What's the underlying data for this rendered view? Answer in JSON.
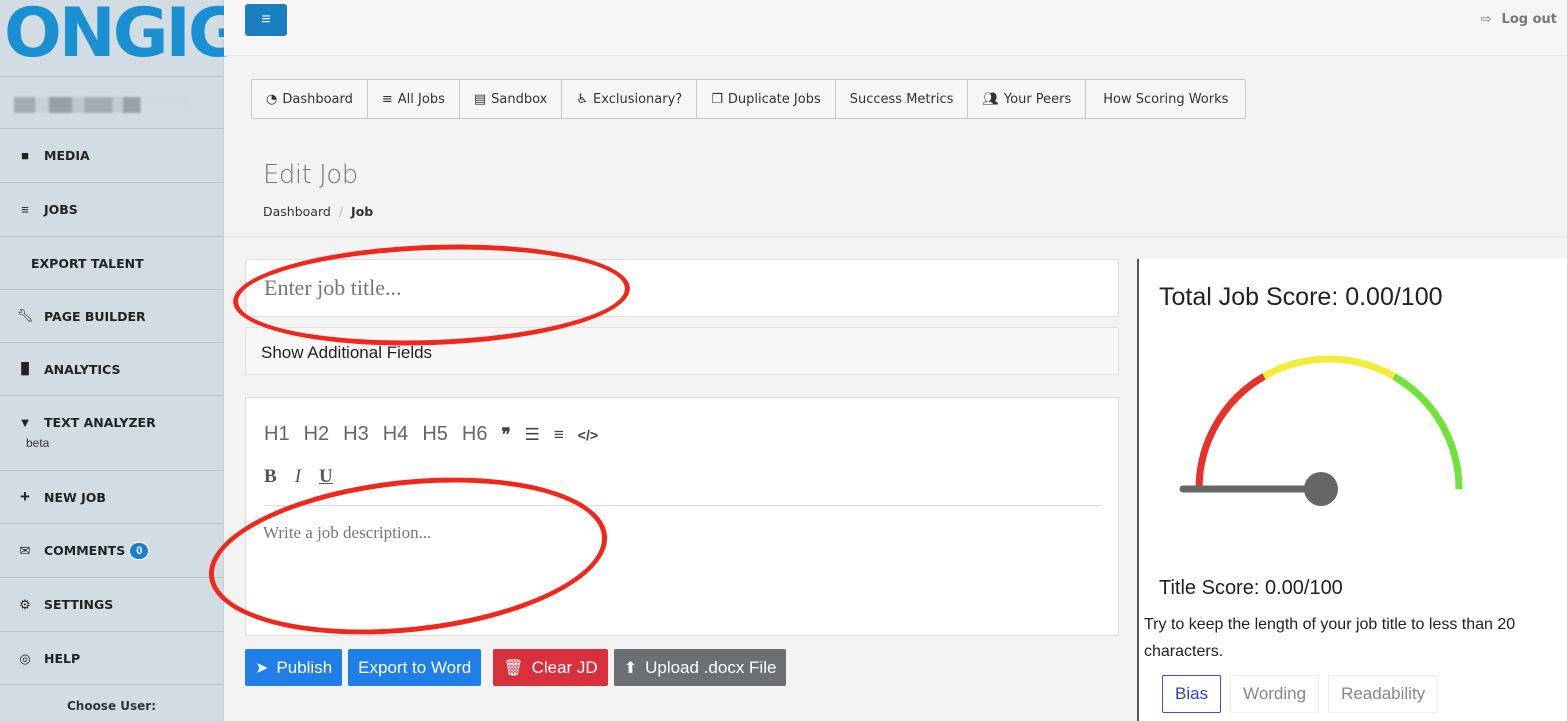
{
  "brand": {
    "logo_text": "ONGIG",
    "logo_color": "#1a8fd2"
  },
  "sidebar": {
    "items": [
      {
        "label": "MEDIA",
        "icon": "video-camera-icon"
      },
      {
        "label": "JOBS",
        "icon": "list-icon"
      },
      {
        "label": "EXPORT TALENT",
        "icon": ""
      },
      {
        "label": "PAGE BUILDER",
        "icon": "wrench-icon"
      },
      {
        "label": "ANALYTICS",
        "icon": "bar-chart-icon"
      },
      {
        "label": "TEXT ANALYZER",
        "sub": "beta",
        "icon": "graduation-cap-icon"
      },
      {
        "label": "NEW JOB",
        "icon": "plus-icon"
      },
      {
        "label": "COMMENTS",
        "badge": "0",
        "icon": "envelope-icon"
      },
      {
        "label": "SETTINGS",
        "icon": "gear-icon"
      },
      {
        "label": "HELP",
        "icon": "life-ring-icon"
      }
    ],
    "choose_user_label": "Choose User:"
  },
  "topbar": {
    "logout_label": "Log out"
  },
  "tabs": [
    {
      "label": "Dashboard",
      "icon": "tachometer-icon"
    },
    {
      "label": "All Jobs",
      "icon": "list-icon"
    },
    {
      "label": "Sandbox",
      "icon": "newspaper-icon"
    },
    {
      "label": "Exclusionary?",
      "icon": "wheelchair-icon"
    },
    {
      "label": "Duplicate Jobs",
      "icon": "copy-icon"
    },
    {
      "label": "Success Metrics",
      "icon": ""
    },
    {
      "label": "Your Peers",
      "icon": "users-icon"
    },
    {
      "label": "How Scoring Works",
      "icon": ""
    }
  ],
  "page": {
    "title": "Edit Job",
    "breadcrumb": {
      "home": "Dashboard",
      "current": "Job"
    }
  },
  "form": {
    "job_title_placeholder": "Enter job title...",
    "additional_fields_label": "Show Additional Fields",
    "toolbar_headings": [
      "H1",
      "H2",
      "H3",
      "H4",
      "H5",
      "H6"
    ],
    "toolbar_symbols": {
      "quote": "❞",
      "bullet_list": "☰",
      "numbered_list": "≡",
      "code": "</>"
    },
    "format_buttons": {
      "bold": "B",
      "italic": "I",
      "underline": "U"
    },
    "description_placeholder": "Write a job description..."
  },
  "actions": {
    "publish": "Publish",
    "export": "Export to Word",
    "clear": "Clear JD",
    "upload": "Upload .docx File"
  },
  "score": {
    "total": "Total Job Score: 0.00/100",
    "gauge_value": 0,
    "gauge_colors": {
      "low": "#e8312a",
      "mid": "#f4ec3a",
      "high": "#6fe33a"
    },
    "title_score": "Title Score: 0.00/100",
    "title_tip": "Try to keep the length of your job title to less than 20 characters.",
    "tabs": [
      "Bias",
      "Wording",
      "Readability"
    ],
    "active_tab": "Bias"
  },
  "colors": {
    "primary_blue": "#1f7fe6",
    "danger_red": "#d9303e",
    "upload_gray": "#6b7074",
    "annotation_red": "#f2271b"
  }
}
